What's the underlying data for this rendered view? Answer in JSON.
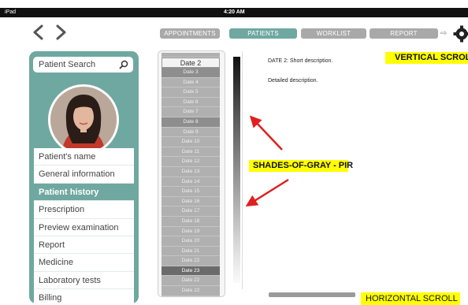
{
  "status_bar": {
    "device": "iPad",
    "time": "4:20 AM"
  },
  "top_tabs": [
    {
      "label": "APPOINTMENTS",
      "active": false
    },
    {
      "label": "PATIENTS",
      "active": true
    },
    {
      "label": "WORKLIST",
      "active": false
    },
    {
      "label": "REPORT",
      "active": false
    }
  ],
  "search": {
    "placeholder": "Patient Search"
  },
  "menu": [
    {
      "label": "Patient's name",
      "active": false
    },
    {
      "label": "General information",
      "active": false
    },
    {
      "label": "Patient history",
      "active": true
    },
    {
      "label": "Prescription",
      "active": false
    },
    {
      "label": "Preview examination",
      "active": false
    },
    {
      "label": "Report",
      "active": false
    },
    {
      "label": "Medicine",
      "active": false
    },
    {
      "label": "Laboratory tests",
      "active": false
    },
    {
      "label": "Billing",
      "active": false
    }
  ],
  "dates": {
    "selected": "Date 2",
    "items": [
      {
        "label": "Date 3",
        "tone": "dark"
      },
      {
        "label": "Date 4",
        "tone": ""
      },
      {
        "label": "Date 5",
        "tone": ""
      },
      {
        "label": "Date 6",
        "tone": ""
      },
      {
        "label": "Date 7",
        "tone": ""
      },
      {
        "label": "Date 8",
        "tone": "dark"
      },
      {
        "label": "Date 9",
        "tone": ""
      },
      {
        "label": "Date 10",
        "tone": ""
      },
      {
        "label": "Date 11",
        "tone": ""
      },
      {
        "label": "Date 12",
        "tone": ""
      },
      {
        "label": "Date 13",
        "tone": ""
      },
      {
        "label": "Date 14",
        "tone": ""
      },
      {
        "label": "Date 15",
        "tone": ""
      },
      {
        "label": "Date 16",
        "tone": ""
      },
      {
        "label": "Date 17",
        "tone": ""
      },
      {
        "label": "Date 18",
        "tone": ""
      },
      {
        "label": "Date 19",
        "tone": ""
      },
      {
        "label": "Date 20",
        "tone": ""
      },
      {
        "label": "Date 21",
        "tone": ""
      },
      {
        "label": "Date 22",
        "tone": ""
      },
      {
        "label": "Date 23",
        "tone": "darker"
      },
      {
        "label": "Date 22",
        "tone": ""
      },
      {
        "label": "Date 22",
        "tone": ""
      }
    ]
  },
  "detail": {
    "short_prefix": "DATE 2:",
    "short_text": "Short description.",
    "long_text": "Detailed description."
  },
  "annotations": {
    "vertical_scroll": "VERTICAL SCROLL",
    "shades": "SHADES-OF-GRAY - PIR",
    "horizontal_scroll": "HORIZONTAL SCROLL"
  },
  "colors": {
    "accent": "#6fa8a0",
    "tab_inactive": "#a9a9a9",
    "annotation_bg": "#ffff00",
    "arrow": "#e02020"
  }
}
